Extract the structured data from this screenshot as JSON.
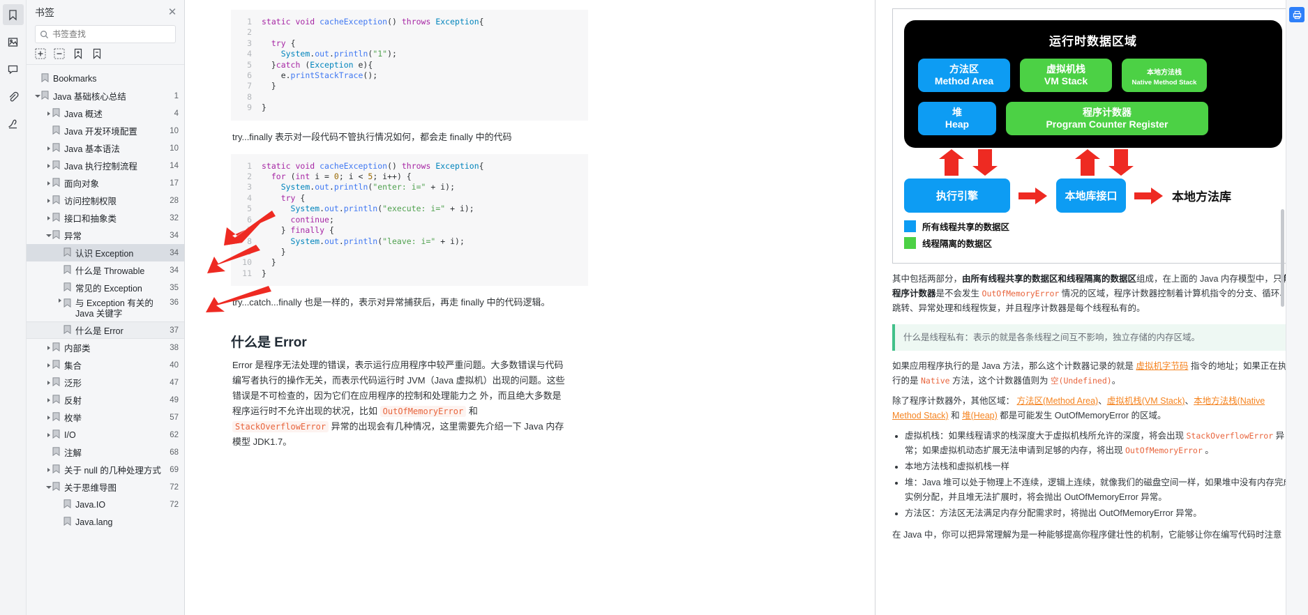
{
  "rail": {
    "items": [
      {
        "name": "bookmark-icon",
        "active": true
      },
      {
        "name": "image-icon",
        "active": false
      },
      {
        "name": "comment-icon",
        "active": false
      },
      {
        "name": "attachment-icon",
        "active": false
      },
      {
        "name": "signature-icon",
        "active": false
      }
    ]
  },
  "bookmarks_panel": {
    "title": "书签",
    "close_label": "✕",
    "search_placeholder": "书签查找",
    "search_value": "",
    "tools": [
      "expand-all-icon",
      "collapse-all-icon",
      "add-bookmark-icon",
      "delete-bookmark-icon"
    ],
    "items": [
      {
        "label": "Bookmarks",
        "page": "",
        "depth": 0,
        "caret": "none",
        "state": "normal"
      },
      {
        "label": "Java 基础核心总结",
        "page": "1",
        "depth": 0,
        "caret": "open",
        "state": "normal"
      },
      {
        "label": "Java 概述",
        "page": "4",
        "depth": 1,
        "caret": "closed",
        "state": "normal"
      },
      {
        "label": "Java 开发环境配置",
        "page": "10",
        "depth": 1,
        "caret": "none",
        "state": "normal"
      },
      {
        "label": "Java 基本语法",
        "page": "10",
        "depth": 1,
        "caret": "closed",
        "state": "normal"
      },
      {
        "label": "Java 执行控制流程",
        "page": "14",
        "depth": 1,
        "caret": "closed",
        "state": "normal"
      },
      {
        "label": "面向对象",
        "page": "17",
        "depth": 1,
        "caret": "closed",
        "state": "normal"
      },
      {
        "label": "访问控制权限",
        "page": "28",
        "depth": 1,
        "caret": "closed",
        "state": "normal"
      },
      {
        "label": "接口和抽象类",
        "page": "32",
        "depth": 1,
        "caret": "closed",
        "state": "normal"
      },
      {
        "label": "异常",
        "page": "34",
        "depth": 1,
        "caret": "open",
        "state": "normal"
      },
      {
        "label": "认识 Exception",
        "page": "34",
        "depth": 2,
        "caret": "none",
        "state": "selected"
      },
      {
        "label": "什么是 Throwable",
        "page": "34",
        "depth": 2,
        "caret": "none",
        "state": "normal"
      },
      {
        "label": "常见的 Exception",
        "page": "35",
        "depth": 2,
        "caret": "none",
        "state": "normal"
      },
      {
        "label": "与 Exception 有关的 Java 关键字",
        "page": "36",
        "depth": 2,
        "caret": "closed",
        "state": "normal",
        "twoline": true
      },
      {
        "label": "什么是 Error",
        "page": "37",
        "depth": 2,
        "caret": "none",
        "state": "outlined"
      },
      {
        "label": "内部类",
        "page": "38",
        "depth": 1,
        "caret": "closed",
        "state": "normal"
      },
      {
        "label": "集合",
        "page": "40",
        "depth": 1,
        "caret": "closed",
        "state": "normal"
      },
      {
        "label": "泛形",
        "page": "47",
        "depth": 1,
        "caret": "closed",
        "state": "normal"
      },
      {
        "label": "反射",
        "page": "49",
        "depth": 1,
        "caret": "closed",
        "state": "normal"
      },
      {
        "label": "枚举",
        "page": "57",
        "depth": 1,
        "caret": "closed",
        "state": "normal"
      },
      {
        "label": "I/O",
        "page": "62",
        "depth": 1,
        "caret": "closed",
        "state": "normal"
      },
      {
        "label": "注解",
        "page": "68",
        "depth": 1,
        "caret": "none",
        "state": "normal"
      },
      {
        "label": "关于 null 的几种处理方式",
        "page": "69",
        "depth": 1,
        "caret": "closed",
        "state": "normal"
      },
      {
        "label": "关于思维导图",
        "page": "72",
        "depth": 1,
        "caret": "open",
        "state": "normal"
      },
      {
        "label": "Java.IO",
        "page": "72",
        "depth": 2,
        "caret": "none",
        "state": "normal"
      },
      {
        "label": "Java.lang",
        "page": "",
        "depth": 2,
        "caret": "none",
        "state": "normal"
      }
    ]
  },
  "document": {
    "code_block_1": {
      "lines": [
        {
          "n": "1",
          "text": "static void cacheException() throws Exception{"
        },
        {
          "n": "2",
          "text": ""
        },
        {
          "n": "3",
          "text": "  try {"
        },
        {
          "n": "4",
          "text": "    System.out.println(\"1\");"
        },
        {
          "n": "5",
          "text": "  }catch (Exception e){"
        },
        {
          "n": "6",
          "text": "    e.printStackTrace();"
        },
        {
          "n": "7",
          "text": "  }"
        },
        {
          "n": "8",
          "text": ""
        },
        {
          "n": "9",
          "text": "}"
        }
      ]
    },
    "para_1": "try...finally 表示对一段代码不管执行情况如何，都会走 finally 中的代码",
    "code_block_2": {
      "lines": [
        {
          "n": "1",
          "text": "static void cacheException() throws Exception{"
        },
        {
          "n": "2",
          "text": "  for (int i = 0; i < 5; i++) {"
        },
        {
          "n": "3",
          "text": "    System.out.println(\"enter: i=\" + i);"
        },
        {
          "n": "4",
          "text": "    try {"
        },
        {
          "n": "5",
          "text": "      System.out.println(\"execute: i=\" + i);"
        },
        {
          "n": "6",
          "text": "      continue;"
        },
        {
          "n": "7",
          "text": "    } finally {"
        },
        {
          "n": "8",
          "text": "      System.out.println(\"leave: i=\" + i);"
        },
        {
          "n": "9",
          "text": "    }"
        },
        {
          "n": "10",
          "text": "  }"
        },
        {
          "n": "11",
          "text": "}"
        }
      ]
    },
    "para_2": "try...catch...finally 也是一样的，表示对异常捕获后，再走 finally 中的代码逻辑。",
    "heading_error": "什么是 Error",
    "error_para_a": "Error 是程序无法处理的错误，表示运行应用程序中较严重问题。大多数错误与代码编写者执行的操作无关，而表示代码运行时 JVM（Java 虚拟机）出现的问题。这些错误是不可检查的，因为它们在应用程序的控制和处理能力之 外，而且绝大多数是程序运行时不允许出现的状况，比如",
    "error_code_1": "OutOfMemoryError",
    "error_and": "和",
    "error_code_2": "StackOverflowError",
    "error_para_b": "异常的出现会有几种情况，这里需要先介绍一下 Java 内存模型 JDK1.7。"
  },
  "jvm_diagram": {
    "runtime_title": "运行时数据区域",
    "blocks": [
      {
        "cn": "方法区",
        "en": "Method Area",
        "color": "#0d9cf3",
        "kind": "blue"
      },
      {
        "cn": "虚拟机栈",
        "en": "VM Stack",
        "color": "#4cd145",
        "kind": "green"
      },
      {
        "cn": "本地方法栈",
        "en": "Native Method Stack",
        "color": "#4cd145",
        "kind": "green-small"
      },
      {
        "cn": "堆",
        "en": "Heap",
        "color": "#0d9cf3",
        "kind": "blue"
      },
      {
        "cn": "程序计数器",
        "en": "Program Counter Register",
        "color": "#4cd145",
        "kind": "green-wide"
      }
    ],
    "exec_engine": "执行引擎",
    "native_interface": "本地库接口",
    "native_library": "本地方法库",
    "legend": [
      {
        "color": "#0d9cf3",
        "text": "所有线程共享的数据区"
      },
      {
        "color": "#4cd145",
        "text": "线程隔离的数据区"
      }
    ]
  },
  "right_text": {
    "p1_a": "其中包括两部分，",
    "p1_b": "由所有线程共享的数据区和线程隔离的数据区",
    "p1_c": "组成，在上面的 Java 内存模型中，只",
    "p1_d": "有程序计数器",
    "p1_e": "是不会发生",
    "p1_code": "OutOfMemoryError",
    "p1_f": "情况的区域，程序计数器控制着计算机指令的分支、循环、跳转、异常处理和线程恢复，并且程序计数器是每个线程私有的。",
    "quote": "什么是线程私有：表示的就是各条线程之间互不影响，独立存储的内存区域。",
    "p2_a": "如果应用程序执行的是 Java 方法，那么这个计数器记录的就是",
    "p2_link1": "虚拟机字节码",
    "p2_b": "指令的地址；如果正在执行的是",
    "p2_code1": "Native",
    "p2_c": "方法，这个计数器值则为",
    "p2_code2": "空(Undefined)",
    "p2_d": "。",
    "p3_a": "除了程序计数器外，其他区域：",
    "p3_link1": "方法区(Method Area)",
    "p3_sep1": "、",
    "p3_link2": "虚拟机栈(VM Stack)",
    "p3_sep2": "、",
    "p3_link3": "本地方法栈(Native Method Stack)",
    "p3_b": "和",
    "p3_link4": "堆(Heap)",
    "p3_c": "都是可能发生 OutOfMemoryError 的区域。",
    "bullets": [
      {
        "a": "虚拟机栈：如果线程请求的栈深度大于虚拟机栈所允许的深度，将会出现 ",
        "code1": "StackOverflowError",
        "b": " 异常；如果虚拟机动态扩展无法申请到足够的内存，将出现 ",
        "code2": "OutOfMemoryError",
        "c": " 。"
      },
      {
        "a": "本地方法栈和虚拟机栈一样",
        "code1": "",
        "b": "",
        "code2": "",
        "c": ""
      },
      {
        "a": "堆：Java 堆可以处于物理上不连续，逻辑上连续，就像我们的磁盘空间一样，如果堆中没有内存完成实例分配，并且堆无法扩展时，将会抛出 OutOfMemoryError 异常。",
        "code1": "",
        "b": "",
        "code2": "",
        "c": ""
      },
      {
        "a": "方法区：方法区无法满足内存分配需求时，将抛出 OutOfMemoryError 异常。",
        "code1": "",
        "b": "",
        "code2": "",
        "c": ""
      }
    ],
    "p4": "在 Java 中，你可以把异常理解为是一种能够提高你程序健壮性的机制，它能够让你在编写代码时注意"
  },
  "edge": {
    "print_button": "print-icon"
  }
}
